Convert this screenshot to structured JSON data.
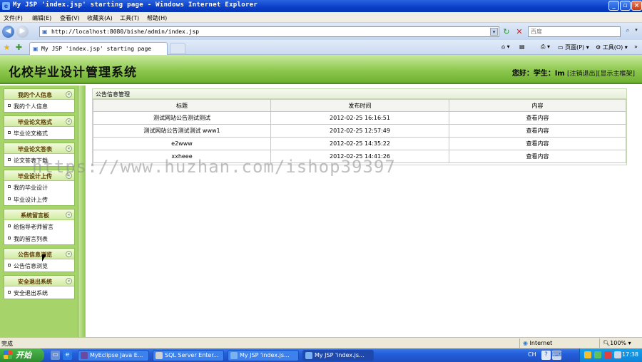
{
  "window": {
    "title": "My JSP 'index.jsp' starting page - Windows Internet Explorer"
  },
  "menu": [
    "文件(F)",
    "编辑(E)",
    "查看(V)",
    "收藏夹(A)",
    "工具(T)",
    "帮助(H)"
  ],
  "address": {
    "url": "http://localhost:8080/bishe/admin/index.jsp",
    "search_placeholder": "百度"
  },
  "tab": {
    "label": "My JSP 'index.jsp' starting page"
  },
  "toolbar": {
    "page_label": "页面(P)",
    "tools_label": "工具(O)"
  },
  "site": {
    "title": "化校毕业设计管理系统",
    "welcome_prefix": "您好：学生：",
    "user": "lm",
    "logout": "[注销退出]",
    "home": "[显示主框架]"
  },
  "sidebar": {
    "groups": [
      {
        "title": "我的个人信息",
        "items": [
          "我的个人信息"
        ]
      },
      {
        "title": "毕业论文格式",
        "items": [
          "毕业论文格式"
        ]
      },
      {
        "title": "毕业论文答表",
        "items": [
          "论文答表下载"
        ]
      },
      {
        "title": "毕业设计上传",
        "items": [
          "我的毕业设计",
          "毕业设计上传"
        ]
      },
      {
        "title": "系统留言板",
        "items": [
          "给指导老师留言",
          "我的留言列表"
        ]
      },
      {
        "title": "公告信息浏览",
        "items": [
          "公告信息浏览"
        ]
      },
      {
        "title": "安全退出系统",
        "items": [
          "安全退出系统"
        ]
      }
    ]
  },
  "notice": {
    "heading": "公告信息管理",
    "columns": [
      "标题",
      "发布时间",
      "内容"
    ],
    "rows": [
      {
        "title": "测试网站公告测试测试",
        "time": "2012-02-25 16:16:51",
        "action": "查看内容"
      },
      {
        "title": "测试网站公告测试测试 www1",
        "time": "2012-02-25 12:57:49",
        "action": "查看内容"
      },
      {
        "title": "e2www",
        "time": "2012-02-25 14:35:22",
        "action": "查看内容"
      },
      {
        "title": "xxheee",
        "time": "2012-02-25 14:41:26",
        "action": "查看内容"
      }
    ]
  },
  "watermark": "https://www.huzhan.com/ishop39397",
  "status": {
    "text": "完成",
    "zone": "Internet",
    "zoom": "100%"
  },
  "taskbar": {
    "start": "开始",
    "tasks": [
      "MyEclipse Java E...",
      "SQL Server Enter...",
      "My JSP 'index.js...",
      "My JSP 'index.js..."
    ],
    "lang": "CH",
    "clock": "17:38"
  },
  "colors": {
    "header_green": "#8ec850",
    "sidebar_green": "#a6d46a",
    "xp_blue": "#245edb"
  }
}
